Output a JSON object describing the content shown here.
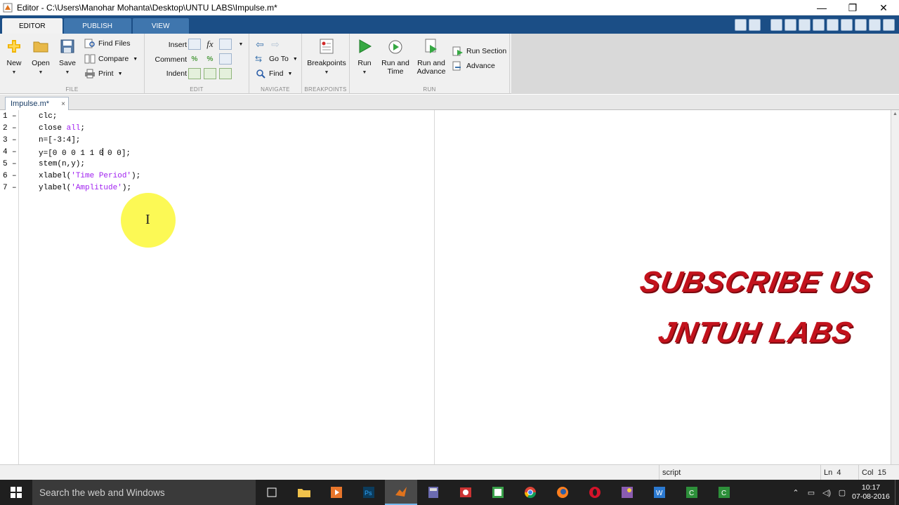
{
  "window": {
    "title": "Editor - C:\\Users\\Manohar Mohanta\\Desktop\\UNTU LABS\\Impulse.m*",
    "minimize": "—",
    "maximize": "❐",
    "close": "✕"
  },
  "ribbon_tabs": [
    "EDITOR",
    "PUBLISH",
    "VIEW"
  ],
  "ribbon": {
    "file": {
      "section_label": "FILE",
      "new": "New",
      "open": "Open",
      "save": "Save",
      "find_files": "Find Files",
      "compare": "Compare",
      "print": "Print"
    },
    "edit": {
      "section_label": "EDIT",
      "insert": "Insert",
      "comment": "Comment",
      "indent": "Indent",
      "fx": "fx"
    },
    "navigate": {
      "section_label": "NAVIGATE",
      "go_to": "Go To",
      "find": "Find"
    },
    "breakpoints": {
      "section_label": "BREAKPOINTS",
      "breakpoints": "Breakpoints"
    },
    "run": {
      "section_label": "RUN",
      "run": "Run",
      "run_and_time_1": "Run and",
      "run_and_time_2": "Time",
      "run_and_advance_1": "Run and",
      "run_and_advance_2": "Advance",
      "run_section": "Run Section",
      "advance": "Advance"
    }
  },
  "document_tab": {
    "label": "Impulse.m*",
    "close": "×"
  },
  "code_lines": [
    {
      "num": "1",
      "marker": "–",
      "parts": [
        {
          "t": "clc;",
          "c": ""
        }
      ]
    },
    {
      "num": "2",
      "marker": "–",
      "parts": [
        {
          "t": "close ",
          "c": ""
        },
        {
          "t": "all",
          "c": "kw"
        },
        {
          "t": ";",
          "c": ""
        }
      ]
    },
    {
      "num": "3",
      "marker": "–",
      "parts": [
        {
          "t": "n=[-3:4];",
          "c": ""
        }
      ]
    },
    {
      "num": "4",
      "marker": "–",
      "parts": [
        {
          "t": "y=[0 0 0 1 1 0",
          "c": ""
        },
        {
          "t": "|",
          "c": "cursor"
        },
        {
          "t": " 0 0];",
          "c": ""
        }
      ]
    },
    {
      "num": "5",
      "marker": "–",
      "parts": [
        {
          "t": "stem(n,y);",
          "c": ""
        }
      ]
    },
    {
      "num": "6",
      "marker": "–",
      "parts": [
        {
          "t": "xlabel(",
          "c": ""
        },
        {
          "t": "'Time Period'",
          "c": "str"
        },
        {
          "t": ");",
          "c": ""
        }
      ]
    },
    {
      "num": "7",
      "marker": "–",
      "parts": [
        {
          "t": "ylabel(",
          "c": ""
        },
        {
          "t": "'Amplitude'",
          "c": "str"
        },
        {
          "t": ");",
          "c": ""
        }
      ]
    }
  ],
  "watermark": {
    "line1": "SUBSCRIBE US",
    "line2": "JNTUH LABS"
  },
  "status": {
    "mode": "script",
    "ln_label": "Ln",
    "ln": "4",
    "col_label": "Col",
    "col": "15"
  },
  "taskbar": {
    "search_placeholder": "Search the web and Windows",
    "time": "10:17",
    "date": "07-08-2016"
  },
  "colors": {
    "ribbon_tab_bar": "#1b4e86",
    "keyword": "#a020f0",
    "watermark": "#c3121c",
    "cursor_highlight": "#fcf846"
  }
}
